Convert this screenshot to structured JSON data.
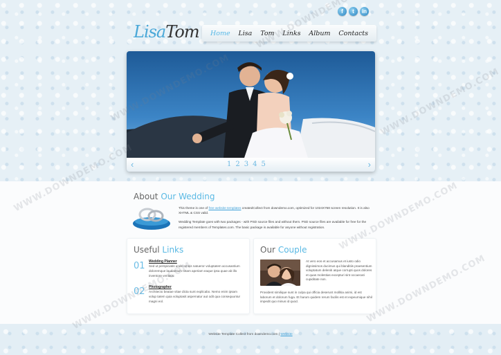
{
  "social": {
    "icons": [
      "f",
      "t",
      "in"
    ]
  },
  "logo": {
    "part1": "Lisa",
    "part2": "Tom"
  },
  "nav": {
    "items": [
      "Home",
      "Lisa",
      "Tom",
      "Links",
      "Album",
      "Contacts"
    ],
    "active_index": 0
  },
  "slider": {
    "prev": "‹",
    "next": "›",
    "pages": [
      "1",
      "2",
      "3",
      "4",
      "5"
    ]
  },
  "about": {
    "title_plain": "About",
    "title_accent": "Our Wedding",
    "p1_pre": "This theme is one of",
    "p1_link": "free website templates",
    "p1_post": "createdCollect from downdemo.com, optimized for 1024X768 screen resolution. It is also XHTML & CSS valid.",
    "p2": "Wedding Template goes with two packages - with PSD source files and without them. PSD source files are available for free for the registered members of Templates.com. The basic package is available for anyone without registration."
  },
  "links": {
    "title_plain": "Useful",
    "title_accent": "Links",
    "items": [
      {
        "num": "01",
        "title": "Wedding Planner",
        "text": "Sed ut perspiciatis unde omnis natueror voluptatem accusantium doloremque laudantium totam aperiam eaque ipsa quae ab illo inventore veritatis."
      },
      {
        "num": "02",
        "title": "Photographer",
        "text": "Architecto beatae vitae dicta sunt explicabo. Nemo enim ipsam volup tatem quia voluptasit aspernatur aut odit qua consequuntur magni eol."
      }
    ]
  },
  "couple": {
    "title_plain": "Our",
    "title_accent": "Couple",
    "side": "At vero eos et accusamus et iusto odio dignissimos ducimus qui blanditiis praesentium voluptatum deleniti atque corrupti quos dolores et quas molestias excepturi sint occaecati cupiditate non.",
    "bottom": "Provident similique sunt in culpa qui officia deserunt mollitia animi, id est laborum et dolorum fuga. Et harum quidem rerum facilis est et expeurnique nihil impedit quo minus id quod."
  },
  "footer": {
    "text": "Website Template Collect from downdemo.com |",
    "link": "Website"
  },
  "watermark": "WWW.DOWNDEMO.COM"
}
